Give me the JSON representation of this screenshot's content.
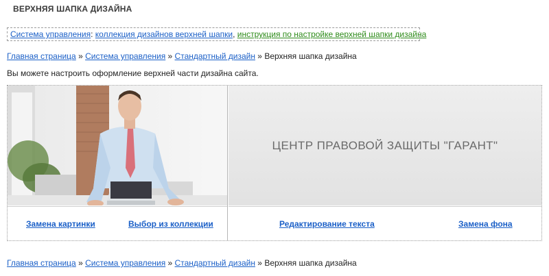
{
  "page": {
    "title": "ВЕРХНЯЯ ШАПКА ДИЗАЙНА"
  },
  "links_box": {
    "link1": "Система управления",
    "colon": ": ",
    "link2": "коллекция дизайнов верхней шапки",
    "comma": ", ",
    "link3": "инструкция по настройке верхней шапки дизайна"
  },
  "breadcrumb": {
    "items": [
      "Главная страница",
      "Система управления",
      "Стандартный дизайн"
    ],
    "separator": " » ",
    "current": "Верхняя шапка дизайна"
  },
  "intro": "Вы можете настроить оформление верхней части дизайна сайта.",
  "header_preview": {
    "text": "ЦЕНТР ПРАВОВОЙ ЗАЩИТЫ \"ГАРАНТ\""
  },
  "actions": {
    "replace_image": "Замена картинки",
    "choose_collection": "Выбор из коллекции",
    "edit_text": "Редактирование текста",
    "replace_bg": "Замена фона"
  },
  "colors": {
    "link": "#1a5fc7",
    "link_green": "#2e8b1a"
  }
}
